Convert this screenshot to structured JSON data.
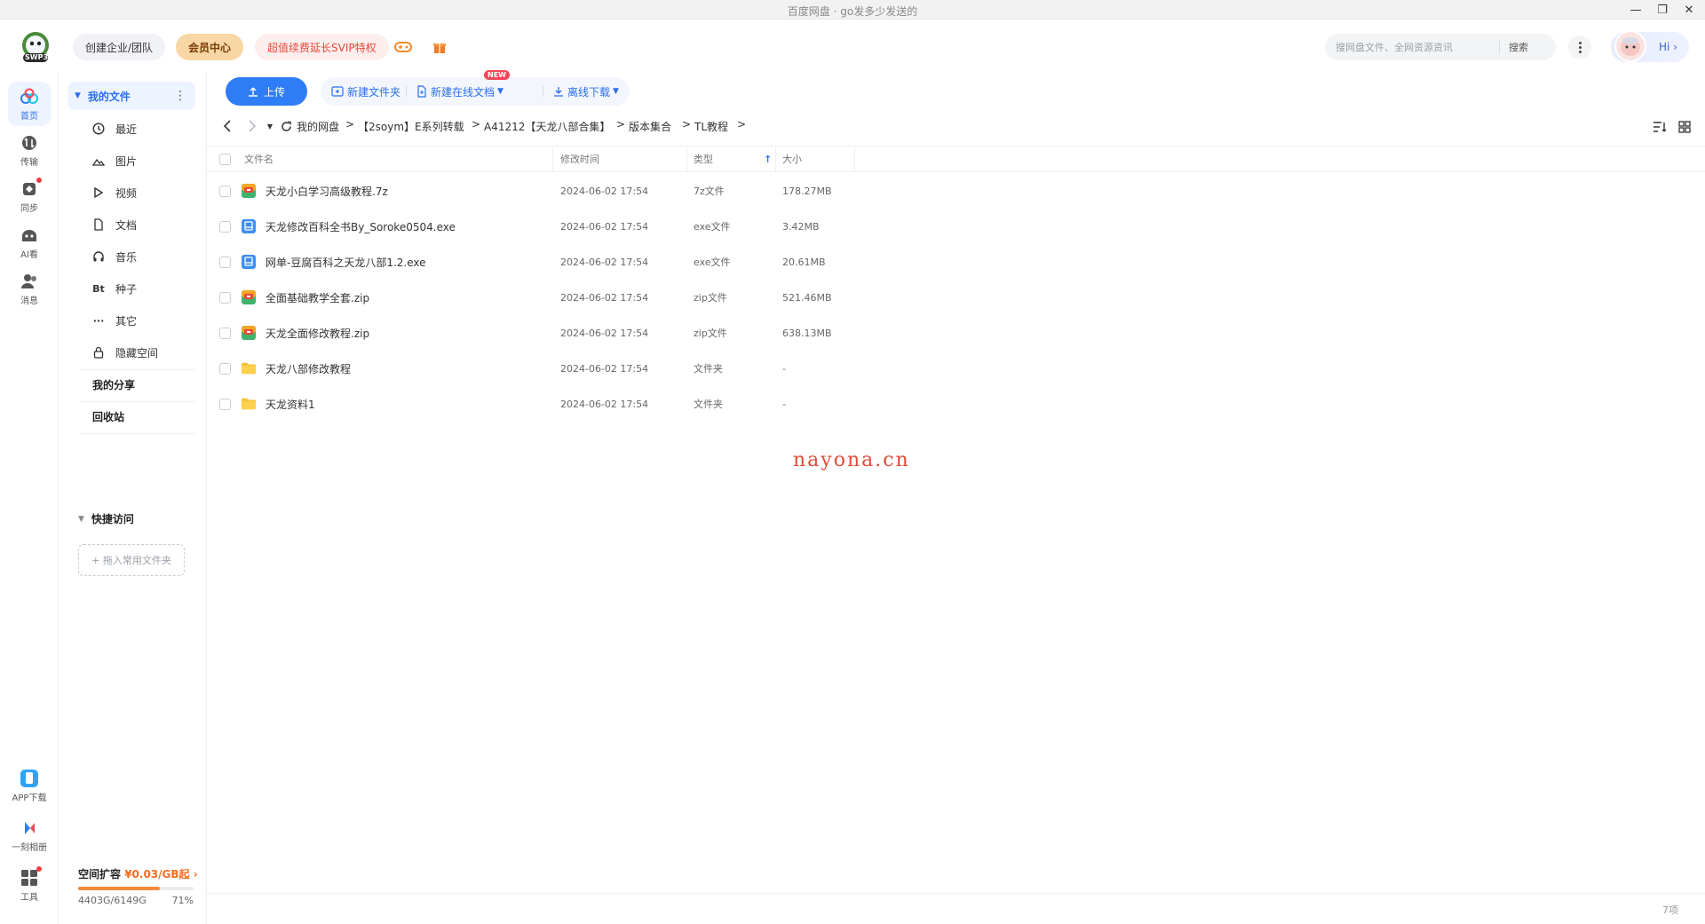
{
  "window": {
    "title": "百度网盘 · go发多少发送的",
    "minimize": "—",
    "restore": "❐",
    "close": "✕"
  },
  "header": {
    "logo_text": "SWP3",
    "team_button": "创建企业/团队",
    "vip_button": "会员中心",
    "svip_promo": "超值续费延长SVIP特权",
    "game_icon": "gamepad-icon",
    "gift_icon": "gift-icon",
    "search_placeholder": "搜网盘文件、全网资源资讯",
    "search_button": "搜索",
    "hi_label": "Hi ›"
  },
  "leftnav": {
    "items": [
      {
        "label": "首页",
        "icon": "home-cloud-icon",
        "active": true
      },
      {
        "label": "传输",
        "icon": "transfer-icon",
        "active": false
      },
      {
        "label": "同步",
        "icon": "sync-icon",
        "active": false
      },
      {
        "label": "AI看",
        "icon": "ai-icon",
        "active": false
      },
      {
        "label": "消息",
        "icon": "message-icon",
        "active": false
      }
    ],
    "bottom_items": [
      {
        "label": "APP下载",
        "icon": "phone-icon"
      },
      {
        "label": "一刻相册",
        "icon": "album-icon"
      },
      {
        "label": "工具",
        "icon": "tools-icon"
      }
    ]
  },
  "sidebar": {
    "my_files": "我的文件",
    "categories": [
      {
        "label": "最近",
        "icon": "clock-icon"
      },
      {
        "label": "图片",
        "icon": "image-icon"
      },
      {
        "label": "视频",
        "icon": "play-icon"
      },
      {
        "label": "文档",
        "icon": "document-icon"
      },
      {
        "label": "音乐",
        "icon": "headphones-icon"
      },
      {
        "label": "种子",
        "icon": "bt-icon",
        "glyph": "Bt"
      },
      {
        "label": "其它",
        "icon": "more-dots-icon",
        "glyph": "···"
      },
      {
        "label": "隐藏空间",
        "icon": "lock-icon"
      }
    ],
    "my_share": "我的分享",
    "recycle_bin": "回收站",
    "quick_access": "快捷访问",
    "drop_hint": "+ 拖入常用文件夹",
    "quota": {
      "title": "空间扩容",
      "price": "¥0.03/GB起",
      "arrow": "›",
      "used": "4403G/6149G",
      "percent_label": "71%",
      "percent_value": 0.71
    }
  },
  "toolbar": {
    "upload": "上传",
    "new_folder": "新建文件夹",
    "new_online_doc": "新建在线文档",
    "new_badge": "NEW",
    "offline_download": "离线下载"
  },
  "breadcrumb": {
    "items": [
      "我的网盘",
      "【2soym】E系列转载",
      "A41212【天龙八部合集】",
      "版本集合",
      "TL教程"
    ],
    "separator": ">"
  },
  "table": {
    "columns": {
      "name": "文件名",
      "modified": "修改时间",
      "type": "类型",
      "size": "大小"
    },
    "sort_indicator": "↑",
    "rows": [
      {
        "name": "天龙小白学习高级教程.7z",
        "modified": "2024-06-02 17:54",
        "type": "7z文件",
        "size": "178.27MB",
        "icon": "archive-icon"
      },
      {
        "name": "天龙修改百科全书By_Soroke0504.exe",
        "modified": "2024-06-02 17:54",
        "type": "exe文件",
        "size": "3.42MB",
        "icon": "exe-icon"
      },
      {
        "name": "网单-豆腐百科之天龙八部1.2.exe",
        "modified": "2024-06-02 17:54",
        "type": "exe文件",
        "size": "20.61MB",
        "icon": "exe-icon"
      },
      {
        "name": "全面基础教学全套.zip",
        "modified": "2024-06-02 17:54",
        "type": "zip文件",
        "size": "521.46MB",
        "icon": "archive-icon"
      },
      {
        "name": "天龙全面修改教程.zip",
        "modified": "2024-06-02 17:54",
        "type": "zip文件",
        "size": "638.13MB",
        "icon": "archive-icon"
      },
      {
        "name": "天龙八部修改教程",
        "modified": "2024-06-02 17:54",
        "type": "文件夹",
        "size": "-",
        "icon": "folder-icon"
      },
      {
        "name": "天龙资料1",
        "modified": "2024-06-02 17:54",
        "type": "文件夹",
        "size": "-",
        "icon": "folder-icon"
      }
    ]
  },
  "watermark": "nayona.cn",
  "status": {
    "count": "7项"
  },
  "colors": {
    "accent": "#2f7df6",
    "accent_text": "#2a6ff0",
    "vip": "#f8d7a5",
    "promo_red": "#e64a3a",
    "quota_orange": "#f26d21",
    "watermark": "#e24a36"
  }
}
